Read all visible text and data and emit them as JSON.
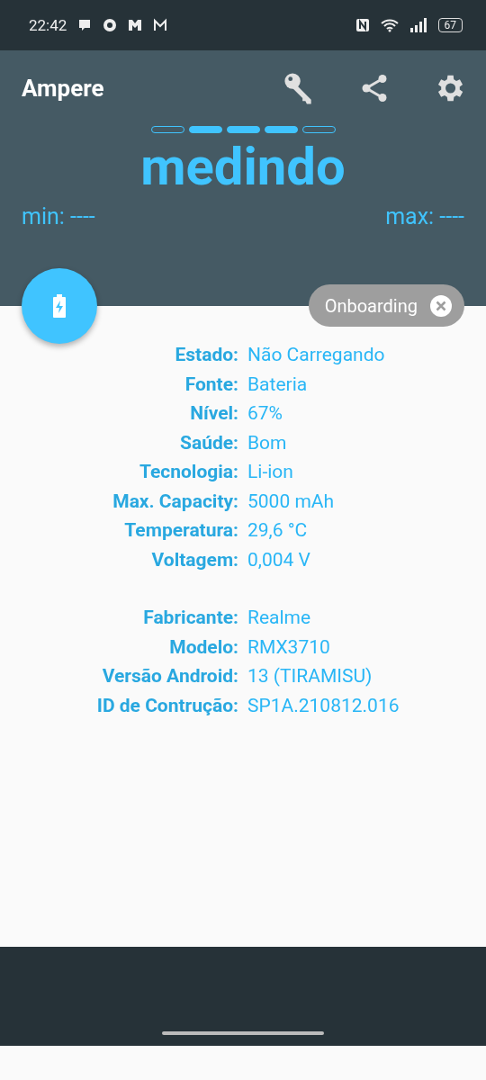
{
  "status_bar": {
    "time": "22:42",
    "battery": "67"
  },
  "app_bar": {
    "title": "Ampere"
  },
  "progress": {
    "segments": [
      {
        "filled": false
      },
      {
        "filled": true
      },
      {
        "filled": true
      },
      {
        "filled": true
      },
      {
        "filled": false
      }
    ]
  },
  "reading": "medindo",
  "min": "min: ----",
  "max": "max: ----",
  "chip": {
    "label": "Onboarding"
  },
  "groups": [
    [
      {
        "label": "Estado:",
        "value": "Não Carregando"
      },
      {
        "label": "Fonte:",
        "value": "Bateria"
      },
      {
        "label": "Nível:",
        "value": "67%"
      },
      {
        "label": "Saúde:",
        "value": "Bom"
      },
      {
        "label": "Tecnologia:",
        "value": "Li-ion"
      },
      {
        "label": "Max. Capacity:",
        "value": "5000 mAh"
      },
      {
        "label": "Temperatura:",
        "value": "29,6 °C"
      },
      {
        "label": "Voltagem:",
        "value": "0,004 V"
      }
    ],
    [
      {
        "label": "Fabricante:",
        "value": "Realme"
      },
      {
        "label": "Modelo:",
        "value": "RMX3710"
      },
      {
        "label": "Versão Android:",
        "value": "13 (TIRAMISU)"
      },
      {
        "label": "ID de Contrução:",
        "value": "SP1A.210812.016"
      }
    ]
  ]
}
